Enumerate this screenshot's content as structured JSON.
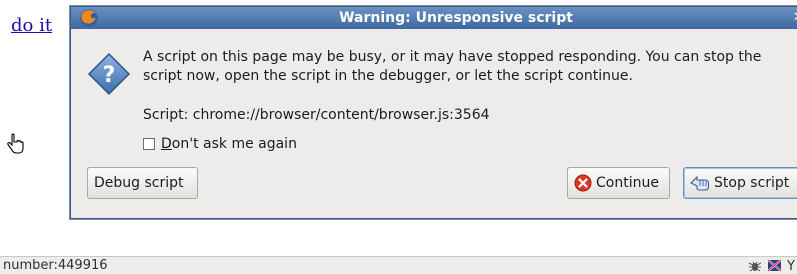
{
  "page": {
    "link_text": "do it",
    "status_text": "number:449916",
    "status_tail": "Y"
  },
  "dialog": {
    "title": "Warning: Unresponsive script",
    "message": "A script on this page may be busy, or it may have stopped responding. You can stop the script now, open the script in the debugger, or let the script continue.",
    "script_label": "Script: chrome://browser/content/browser.js:3564",
    "checkbox": {
      "mnemonic": "D",
      "label_rest": "on't ask me again",
      "checked": false
    },
    "buttons": {
      "debug": "Debug script",
      "continue": "Continue",
      "stop": "Stop script"
    }
  },
  "colors": {
    "titlebar": "#4a74aa",
    "link": "#1a0dab",
    "continue_icon": "#d93a23"
  },
  "icons": [
    "firefox-icon",
    "question-icon",
    "hand-cursor-icon",
    "stop-icon",
    "stop-script-hand-icon",
    "bug-icon",
    "status-flag-icon"
  ]
}
